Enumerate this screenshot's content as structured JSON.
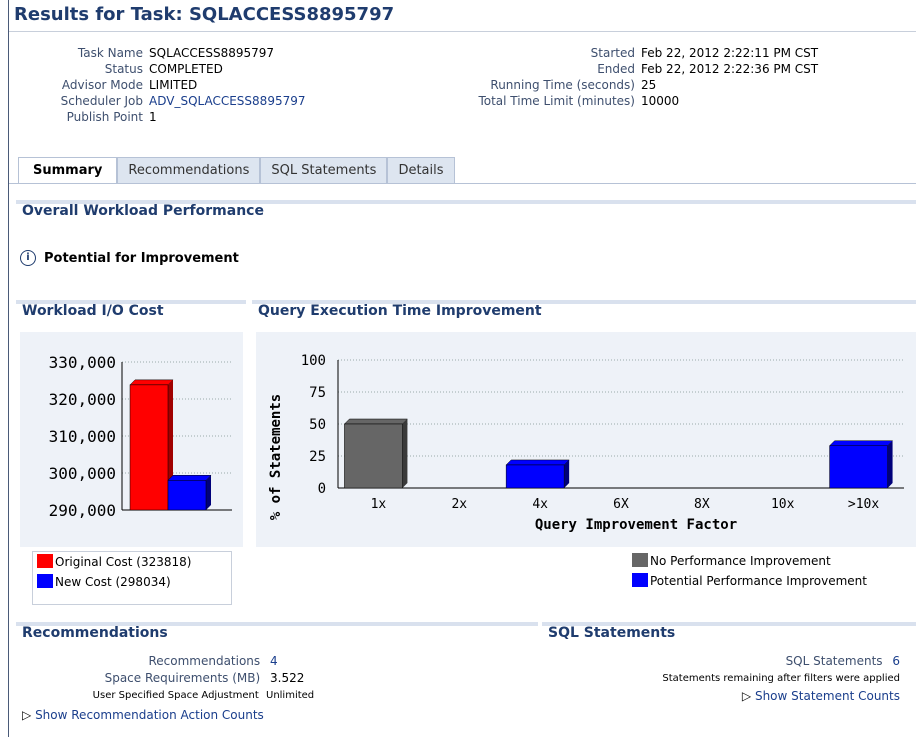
{
  "title": "Results for Task: SQLACCESS8895797",
  "task_info": {
    "left": [
      {
        "label": "Task Name",
        "value": "SQLACCESS8895797"
      },
      {
        "label": "Status",
        "value": "COMPLETED"
      },
      {
        "label": "Advisor Mode",
        "value": "LIMITED"
      },
      {
        "label": "Scheduler Job",
        "value": "ADV_SQLACCESS8895797"
      },
      {
        "label": "Publish Point",
        "value": "1"
      }
    ],
    "right": [
      {
        "label": "Started",
        "value": "Feb 22, 2012 2:22:11 PM CST"
      },
      {
        "label": "Ended",
        "value": "Feb 22, 2012 2:22:36 PM CST"
      },
      {
        "label": "Running Time (seconds)",
        "value": "25"
      },
      {
        "label": "Total Time Limit (minutes)",
        "value": "10000"
      }
    ]
  },
  "tabs": [
    "Summary",
    "Recommendations",
    "SQL Statements",
    "Details"
  ],
  "overall_header": "Overall Workload Performance",
  "potential": "Potential for Improvement",
  "io_header": "Workload I/O Cost",
  "qet_header": "Query Execution Time Improvement",
  "colors": {
    "original": "#ff0000",
    "new": "#0000ff",
    "no_improvement": "#666666",
    "potential": "#0000ff"
  },
  "chart_data": [
    {
      "type": "bar",
      "title": "Workload I/O Cost",
      "categories": [
        "Original Cost (323818)",
        "New Cost (298034)"
      ],
      "values": [
        323818,
        298034
      ],
      "yticks": [
        "330,000",
        "320,000",
        "310,000",
        "300,000",
        "290,000"
      ],
      "ylim": [
        290000,
        330000
      ],
      "legend": [
        "Original Cost (323818)",
        "New Cost (298034)"
      ],
      "grid": true
    },
    {
      "type": "bar",
      "title": "Query Execution Time Improvement",
      "categories": [
        "1x",
        "2x",
        "4x",
        "6X",
        "8X",
        "10x",
        ">10x"
      ],
      "series": [
        {
          "name": "No Performance Improvement",
          "values": [
            50,
            0,
            0,
            0,
            0,
            0,
            0
          ]
        },
        {
          "name": "Potential Performance Improvement",
          "values": [
            0,
            0,
            18,
            0,
            0,
            0,
            33
          ]
        }
      ],
      "xlabel": "Query Improvement Factor",
      "ylabel": "% of Statements",
      "yticks": [
        "100",
        "75",
        "50",
        "25",
        "0"
      ],
      "ylim": [
        0,
        100
      ],
      "grid": true,
      "legend_position": "bottom-right"
    }
  ],
  "recommendations": {
    "header": "Recommendations",
    "count_label": "Recommendations",
    "count_value": "4",
    "space_label": "Space Requirements (MB)",
    "space_value": "3.522",
    "adjust_label": "User Specified Space Adjustment",
    "adjust_value": "Unlimited",
    "link": "Show Recommendation Action Counts"
  },
  "sql": {
    "header": "SQL Statements",
    "count_label": "SQL Statements",
    "count_value": "6",
    "note": "Statements remaining after filters were applied",
    "link": "Show Statement Counts"
  }
}
